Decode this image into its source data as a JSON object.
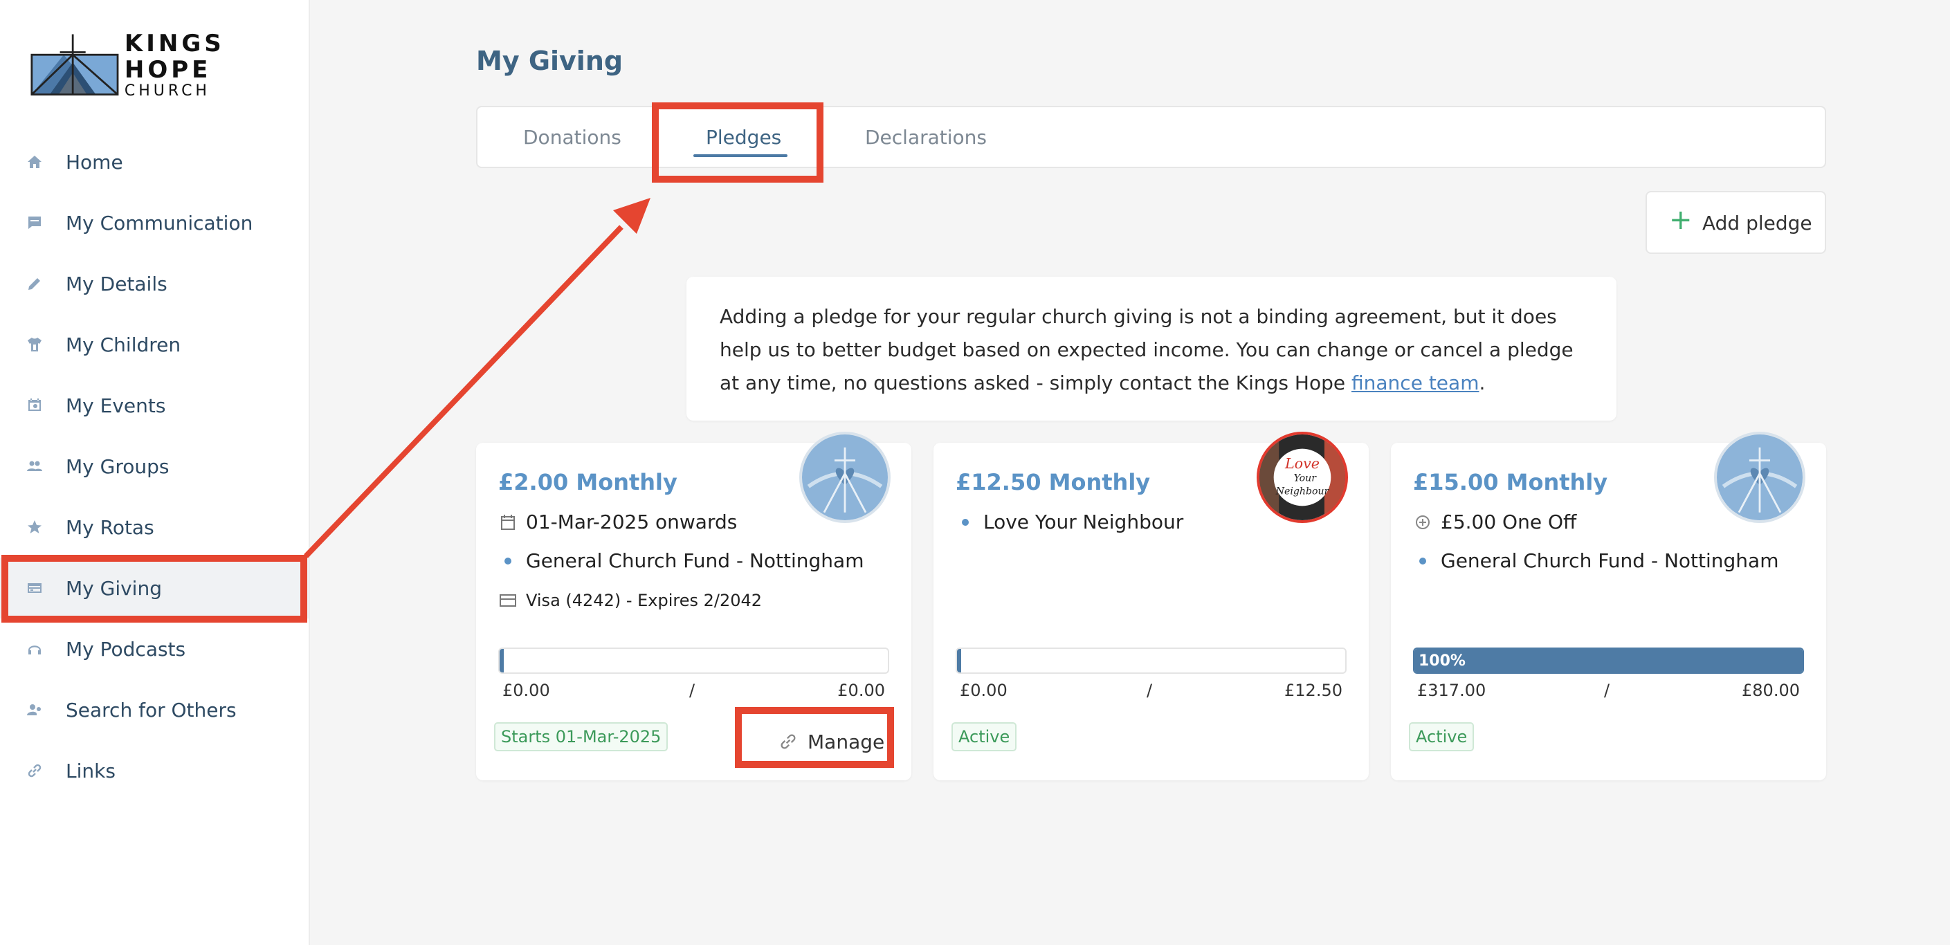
{
  "brand": {
    "name_line1": "KINGS HOPE",
    "name_line2": "CHURCH"
  },
  "sidebar": {
    "items": [
      {
        "label": "Home",
        "icon": "home-icon"
      },
      {
        "label": "My Communication",
        "icon": "chat-icon"
      },
      {
        "label": "My Details",
        "icon": "pencil-icon"
      },
      {
        "label": "My Children",
        "icon": "shirt-icon"
      },
      {
        "label": "My Events",
        "icon": "calendar-clock-icon"
      },
      {
        "label": "My Groups",
        "icon": "people-icon"
      },
      {
        "label": "My Rotas",
        "icon": "star-icon"
      },
      {
        "label": "My Giving",
        "icon": "credit-card-icon",
        "active": true
      },
      {
        "label": "My Podcasts",
        "icon": "headphones-icon"
      },
      {
        "label": "Search for Others",
        "icon": "person-search-icon"
      },
      {
        "label": "Links",
        "icon": "link-icon"
      }
    ]
  },
  "main": {
    "title": "My Giving",
    "tabs": [
      {
        "label": "Donations"
      },
      {
        "label": "Pledges",
        "active": true
      },
      {
        "label": "Declarations"
      }
    ],
    "add_pledge_label": "Add pledge",
    "info": {
      "text_before_link": "Adding a pledge for your regular church giving is not a binding agreement, but it does help us to better budget based on expected income. You can change or cancel a pledge at any time, no questions asked - simply contact the Kings Hope ",
      "link_text": "finance team",
      "text_after_link": "."
    },
    "cards": [
      {
        "title": "£2.00 Monthly",
        "date": "01-Mar-2025 onwards",
        "fund": "General Church Fund - Nottingham",
        "payment": "Visa (4242) - Expires 2/2042",
        "progress": 0,
        "amount_given": "£0.00",
        "separator": "/",
        "amount_target": "£0.00",
        "status": "Starts 01-Mar-2025",
        "manage_label": "Manage"
      },
      {
        "title": "£12.50 Monthly",
        "fund": "Love Your Neighbour",
        "progress": 0,
        "amount_given": "£0.00",
        "separator": "/",
        "amount_target": "£12.50",
        "status": "Active",
        "avatar_text_1": "Love",
        "avatar_text_2": "Your",
        "avatar_text_3": "Neighbour"
      },
      {
        "title": "£15.00 Monthly",
        "one_off": "£5.00 One Off",
        "fund": "General Church Fund - Nottingham",
        "progress": 100,
        "progress_label": "100%",
        "amount_given": "£317.00",
        "separator": "/",
        "amount_target": "£80.00",
        "status": "Active"
      }
    ]
  },
  "colors": {
    "accent": "#4e7ba5",
    "title": "#3e6483",
    "card_title": "#5b93c6",
    "success": "#3c9a5a",
    "annotation": "#e54530"
  }
}
